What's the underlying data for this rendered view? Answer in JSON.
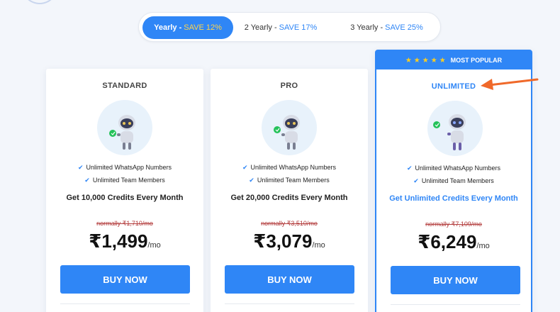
{
  "billing": {
    "tabs": [
      {
        "label": "Yearly -",
        "save": "SAVE 12%"
      },
      {
        "label": "2 Yearly -",
        "save": "SAVE 17%"
      },
      {
        "label": "3 Yearly -",
        "save": "SAVE 25%"
      }
    ],
    "selected": "Yearly"
  },
  "plans": [
    {
      "name": "STANDARD",
      "features": [
        "Unlimited WhatsApp Numbers",
        "Unlimited Team Members"
      ],
      "credits": "Get 10,000 Credits Every Month",
      "normally": "normally ₹1,710/mo",
      "price": "₹1,499",
      "unit": "/mo",
      "cta": "BUY NOW"
    },
    {
      "name": "PRO",
      "features": [
        "Unlimited WhatsApp Numbers",
        "Unlimited Team Members"
      ],
      "credits": "Get 20,000 Credits Every Month",
      "normally": "normally ₹3,510/mo",
      "price": "₹3,079",
      "unit": "/mo",
      "cta": "BUY NOW"
    },
    {
      "name": "UNLIMITED",
      "badge": "MOST POPULAR",
      "badge_stars": "★★★★★",
      "features": [
        "Unlimited WhatsApp Numbers",
        "Unlimited Team Members"
      ],
      "credits": "Get Unlimited Credits Every Month",
      "normally": "normally ₹7,109/mo",
      "price": "₹6,249",
      "unit": "/mo",
      "cta": "BUY NOW"
    }
  ],
  "icons": {
    "feature": "check-icon",
    "mascot": "robot-mascot-icon",
    "badge": "star-icon",
    "annotation": "arrow-left-icon"
  },
  "colors": {
    "accent": "#2f86f6",
    "save_highlight": "#ffd34a",
    "strike": "#b23a3a",
    "arrow": "#f0692a"
  }
}
